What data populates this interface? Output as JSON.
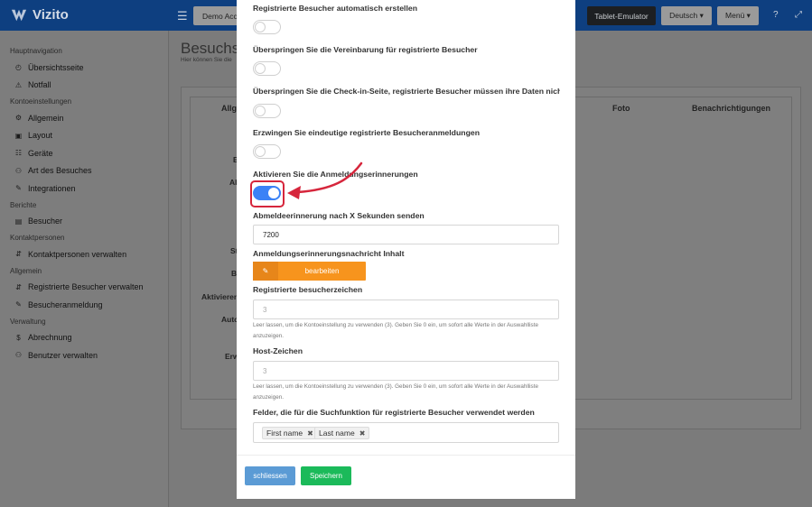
{
  "app": {
    "brand": "Vizito"
  },
  "topbar": {
    "account_label": "Demo Account",
    "tablet_label": "Tablet-Emulator",
    "language_label": "Deutsch ▾",
    "menu_label": "Menü ▾",
    "menu_icon": "☰",
    "help_icon": "?",
    "expand_icon": "⤢"
  },
  "sidebar": {
    "sections": [
      {
        "title": "Hauptnavigation",
        "items": [
          {
            "label": "Übersichtsseite",
            "icon": "◴"
          },
          {
            "label": "Notfall",
            "icon": "⚠"
          }
        ]
      },
      {
        "title": "Kontoeinstellungen",
        "items": [
          {
            "label": "Allgemein",
            "icon": "⚙"
          },
          {
            "label": "Layout",
            "icon": "▣"
          },
          {
            "label": "Geräte",
            "icon": "☷"
          },
          {
            "label": "Art des Besuches",
            "icon": "⚇"
          },
          {
            "label": "Integrationen",
            "icon": "✎"
          }
        ]
      },
      {
        "title": "Berichte",
        "items": [
          {
            "label": "Besucher",
            "icon": "▤"
          }
        ]
      },
      {
        "title": "Kontaktpersonen",
        "items": [
          {
            "label": "Kontaktpersonen verwalten",
            "icon": "⇵"
          }
        ]
      },
      {
        "title": "Allgemein",
        "items": [
          {
            "label": "Registrierte Besucher verwalten",
            "icon": "⇵"
          },
          {
            "label": "Besucheranmeldung",
            "icon": "✎"
          }
        ]
      },
      {
        "title": "Verwaltung",
        "items": [
          {
            "label": "Abrechnung",
            "icon": "$"
          },
          {
            "label": "Benutzer verwalten",
            "icon": "⚇"
          }
        ]
      }
    ]
  },
  "page": {
    "title": "Besuchsar",
    "subtitle": "Hier können Sie die",
    "columns": [
      "Allge",
      "Foto",
      "Benachrichtigungen"
    ],
    "row_labels": [
      "B",
      "Ab",
      "St",
      "Bi",
      "Aktivieren",
      "Auto",
      "Erw"
    ]
  },
  "modal": {
    "fields": [
      {
        "label": "Registrierte Besucher automatisch erstellen",
        "enabled": false
      },
      {
        "label": "Überspringen Sie die Vereinbarung für registrierte Besucher",
        "enabled": false
      },
      {
        "label": "Überspringen Sie die Check-in-Seite, registrierte Besucher müssen ihre Daten nicht best…",
        "enabled": false
      },
      {
        "label": "Erzwingen Sie eindeutige registrierte Besucheranmeldungen",
        "enabled": false
      },
      {
        "label": "Aktivieren Sie die Anmeldungserinnerungen",
        "enabled": true
      }
    ],
    "reminder_seconds": {
      "label": "Abmeldeerinnerung nach X Sekunden senden",
      "value": "7200"
    },
    "reminder_message": {
      "label": "Anmeldungserinnerungsnachricht Inhalt",
      "button_label": "bearbeiten",
      "button_icon": "✎"
    },
    "visitor_chars": {
      "label": "Registrierte besucherzeichen",
      "placeholder": "3",
      "help": "Leer lassen, um die Kontoeinstellung zu verwenden (3). Geben Sie 0 ein, um sofort alle Werte in der Auswahlliste anzuzeigen."
    },
    "host_chars": {
      "label": "Host-Zeichen",
      "placeholder": "3",
      "help": "Leer lassen, um die Kontoeinstellung zu verwenden (3). Geben Sie 0 ein, um sofort alle Werte in der Auswahlliste anzuzeigen."
    },
    "search_fields": {
      "label": "Felder, die für die Suchfunktion für registrierte Besucher verwendet werden",
      "tags": [
        "First name",
        "Last name"
      ],
      "remove_icon": "✖"
    },
    "close_label": "schliessen",
    "save_label": "Speichern"
  },
  "colors": {
    "topbar": "#0e3f80",
    "toggle_on": "#3b82f6",
    "edit_button": "#f7941d",
    "close_button": "#5b9bd5",
    "save_button": "#1bba5a",
    "highlight": "#d6263c"
  }
}
